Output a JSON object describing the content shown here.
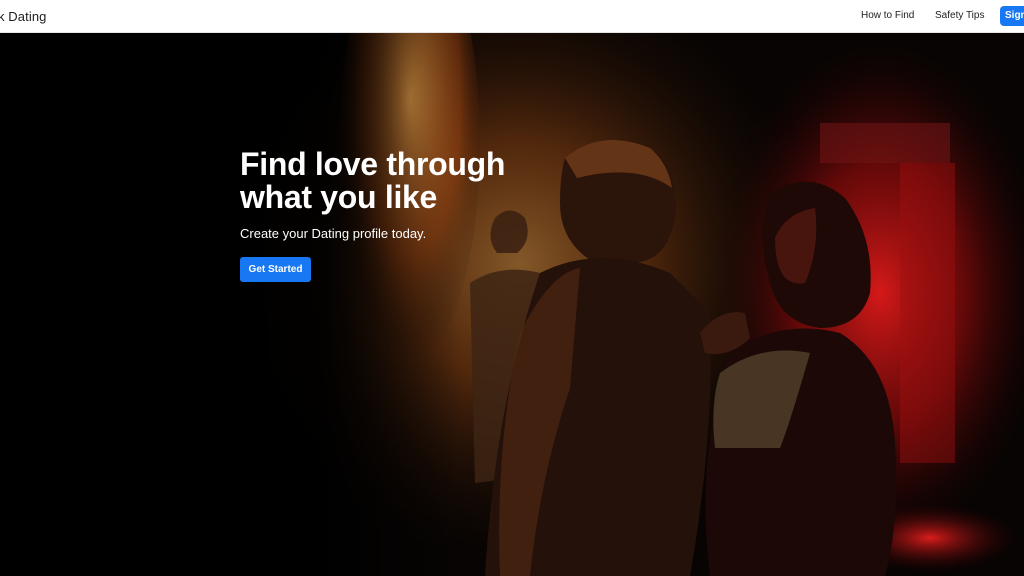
{
  "header": {
    "brand": "book Dating",
    "nav": [
      {
        "label": "How to Find"
      },
      {
        "label": "Safety Tips"
      }
    ],
    "signin_label": "Sign"
  },
  "hero": {
    "headline_line1": "Find love through",
    "headline_line2": "what you like",
    "subhead": "Create your Dating profile today.",
    "cta_label": "Get Started",
    "background_image": "couple-dancing-in-dim-red-lit-bar",
    "colors": {
      "accent": "#1877f2",
      "glow_orange": "#e8832a",
      "glow_red": "#c0141a"
    }
  }
}
